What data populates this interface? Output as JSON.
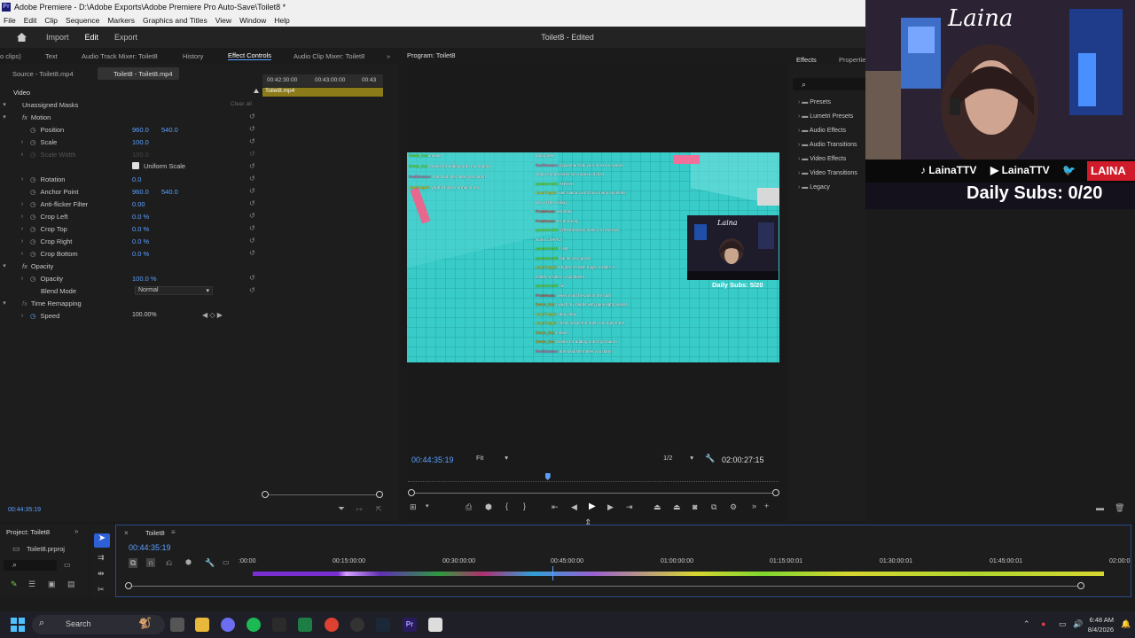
{
  "window": {
    "title": "Adobe Premiere - D:\\Adobe Exports\\Adobe Premiere Pro Auto-Save\\Toilet8 *",
    "logo": "Pr"
  },
  "menu": [
    "File",
    "Edit",
    "Clip",
    "Sequence",
    "Markers",
    "Graphics and Titles",
    "View",
    "Window",
    "Help"
  ],
  "header": {
    "nav": [
      "Import",
      "Edit",
      "Export"
    ],
    "project_title": "Toilet8 - Edited"
  },
  "top_panel_tabs": {
    "left_clip": "o clips)",
    "text": "Text",
    "audio_track_mixer": "Audio Track Mixer: Toilet8",
    "history": "History",
    "effect_controls": "Effect Controls",
    "audio_clip_mixer": "Audio Clip Mixer: Toilet8",
    "program": "Program: Toilet8",
    "effects": "Effects",
    "properties": "Properties"
  },
  "effect_controls": {
    "source_tab": "Source - Toilet8.mp4",
    "clip_tab": "Toilet8 - Toilet8.mp4",
    "mini_timeline": {
      "t1": "00:42:30:00",
      "t2": "00:43:00:00",
      "t3": "00:43",
      "clip": "Toilet8.mp4"
    },
    "section": "Video",
    "masks": "Unassigned Masks",
    "clear_all": "Clear all",
    "motion": "Motion",
    "position": {
      "label": "Position",
      "x": "960.0",
      "y": "540.0"
    },
    "scale": {
      "label": "Scale",
      "value": "100.0"
    },
    "scale_width": {
      "label": "Scale Width",
      "value": "100.0"
    },
    "uniform_scale": "Uniform Scale",
    "rotation": {
      "label": "Rotation",
      "value": "0.0"
    },
    "anchor": {
      "label": "Anchor Point",
      "x": "960.0",
      "y": "540.0"
    },
    "antiflicker": {
      "label": "Anti-flicker Filter",
      "value": "0.00"
    },
    "crop_left": {
      "label": "Crop Left",
      "value": "0.0 %"
    },
    "crop_top": {
      "label": "Crop Top",
      "value": "0.0 %"
    },
    "crop_right": {
      "label": "Crop Right",
      "value": "0.0 %"
    },
    "crop_bottom": {
      "label": "Crop Bottom",
      "value": "0.0 %"
    },
    "opacity_group": "Opacity",
    "opacity": {
      "label": "Opacity",
      "value": "100.0 %"
    },
    "blend": {
      "label": "Blend Mode",
      "value": "Normal"
    },
    "time_remap": "Time Remapping",
    "speed": {
      "label": "Speed",
      "value": "100.00%"
    },
    "timecode": "00:44:35:19"
  },
  "program": {
    "timecode": "00:44:35:19",
    "fit": "Fit",
    "resolution": "1/2",
    "duration": "02:00:27:15",
    "playhead_fraction": 0.37
  },
  "video_frame": {
    "overlay_name": "Laina",
    "overlay_subs": "Daily Subs: 5/20",
    "chat_left": [
      {
        "user": "Bman_lea:",
        "msg": "insane",
        "color": "#7CFC00"
      },
      {
        "user": "Bman_lea:",
        "msg": "thanks for adding onto my trauma",
        "color": "#7CFC00"
      },
      {
        "user": "freshbossxx:",
        "msg": "she said she hates you damn",
        "color": "#ff5fa0"
      },
      {
        "user": "JuanTugott:",
        "msg": "yeah it looks normal to me",
        "color": "#ffd700"
      }
    ],
    "chat_right": [
      {
        "user": "",
        "msg": "going pee",
        "color": "#fff"
      },
      {
        "user": "freshbossxx:",
        "msg": "@yasmancobi your immune system",
        "color": "#ff5fa0"
      },
      {
        "user": "",
        "msg": "would compromise for a speck of dust",
        "color": "#fff"
      },
      {
        "user": "yasmancobi:",
        "msg": "AHHHH",
        "color": "#7CFC00"
      },
      {
        "user": "JuanTugott:",
        "msg": "wait Alaina count how many sprinkles",
        "color": "#ffd700"
      },
      {
        "user": "",
        "msg": "are on the ceiling",
        "color": "#fff"
      },
      {
        "user": "Frostmuss:",
        "msg": "anomaly",
        "color": "#ff4040"
      },
      {
        "user": "Frostmuss:",
        "msg": "it's anomaly",
        "color": "#ff4040"
      },
      {
        "user": "yasmancobi:",
        "msg": "@freshbossxx thats not how that",
        "color": "#7CFC00"
      },
      {
        "user": "",
        "msg": "works LMFAO",
        "color": "#fff"
      },
      {
        "user": "yasmancobi:",
        "msg": "I AM",
        "color": "#7CFC00"
      },
      {
        "user": "yasmancobi:",
        "msg": "but its very gross",
        "color": "#7CFC00"
      },
      {
        "user": "JuanTugott:",
        "msg": "5 lights, 2 trash bags, 8 stalls, 6",
        "color": "#ffd700"
      },
      {
        "user": "",
        "msg": "toilets, 6 sinks, 4 sprinklers",
        "color": "#fff"
      },
      {
        "user": "yasmancobi:",
        "msg": "ok",
        "color": "#7CFC00"
      },
      {
        "user": "Frostmuss:",
        "msg": "never mind he was in the stall",
        "color": "#ff4040"
      },
      {
        "user": "Bman_lea:",
        "msg": "i wash my hands with gamelight passss",
        "color": "#ffa500"
      },
      {
        "user": "JuanTugott:",
        "msg": "okay okay",
        "color": "#ffd700"
      },
      {
        "user": "JuanTugott:",
        "msg": "check inside the trash can right there",
        "color": "#ffd700"
      },
      {
        "user": "Bman_lea:",
        "msg": "insane",
        "color": "#ffa500"
      },
      {
        "user": "Bman_lea:",
        "msg": "thanks for adding onto my trauma",
        "color": "#ffa500"
      },
      {
        "user": "freshbossxx:",
        "msg": "she said she hates you damn",
        "color": "#ff5fa0"
      }
    ]
  },
  "webcam": {
    "name": "Laina",
    "socials": [
      "LainaTTV",
      "LainaTTV",
      "LAINA"
    ],
    "subs": "Daily Subs: 0/20"
  },
  "effects_panel": {
    "items": [
      "Presets",
      "Lumetri Presets",
      "Audio Effects",
      "Audio Transitions",
      "Video Effects",
      "Video Transitions",
      "Legacy"
    ]
  },
  "project_panel": {
    "title": "Project: Toilet8",
    "file": "Toilet8.prproj"
  },
  "timeline": {
    "title": "Toilet8",
    "timecode": "00:44:35:19",
    "ticks": [
      ":00:00",
      "00:15:00:00",
      "00:30:00:00",
      "00:45:00:00",
      "01:00:00:00",
      "01:15:00:01",
      "01:30:00:01",
      "01:45:00:01",
      "02:00:0"
    ]
  },
  "taskbar": {
    "search": "Search",
    "time": "6:48 AM",
    "date": "8/4/2026"
  }
}
